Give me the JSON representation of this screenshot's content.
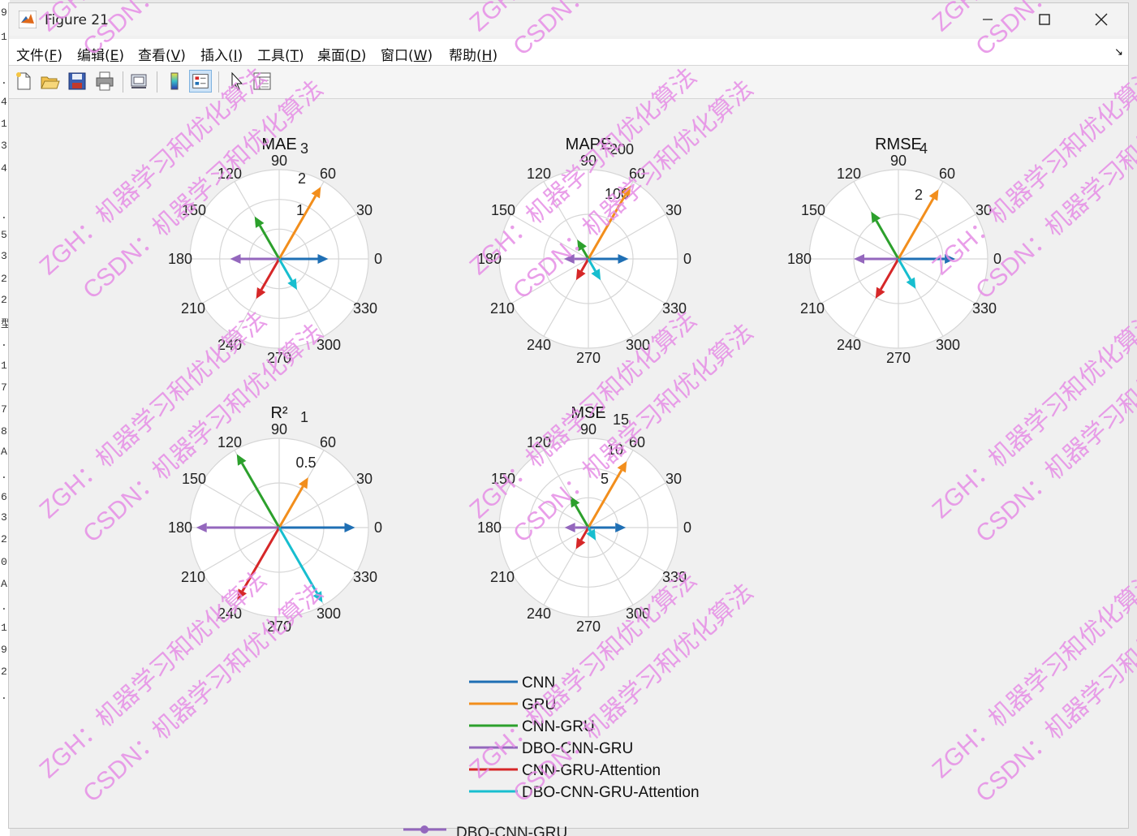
{
  "window": {
    "title": "Figure 21"
  },
  "menu": {
    "items": [
      {
        "label": "文件(",
        "key": "F",
        "tail": ")"
      },
      {
        "label": "编辑(",
        "key": "E",
        "tail": ")"
      },
      {
        "label": "查看(",
        "key": "V",
        "tail": ")"
      },
      {
        "label": "插入(",
        "key": "I",
        "tail": ")"
      },
      {
        "label": "工具(",
        "key": "T",
        "tail": ")"
      },
      {
        "label": "桌面(",
        "key": "D",
        "tail": ")"
      },
      {
        "label": "窗口(",
        "key": "W",
        "tail": ")"
      },
      {
        "label": "帮助(",
        "key": "H",
        "tail": ")"
      }
    ]
  },
  "toolbar": {
    "buttons": [
      "new-figure-icon",
      "open-file-icon",
      "save-icon",
      "print-icon",
      "link-plot-icon",
      "colorbar-icon",
      "legend-icon",
      "edit-plot-cursor-icon",
      "property-inspector-icon"
    ]
  },
  "background_text": {
    "left_gutter": [
      "9",
      "1",
      ".",
      "4",
      "1",
      "3",
      "4",
      ".",
      "5",
      "3",
      "2",
      "2",
      "型",
      ".",
      "1",
      "7",
      "7",
      "8",
      "At",
      ".",
      "6",
      "3",
      "2",
      "0",
      "At",
      ".",
      "1",
      "9",
      "2",
      "."
    ],
    "bottom_legend_fragment": "DBO-CNN-GRU"
  },
  "colors": {
    "CNN": "#1f6fb4",
    "GRU": "#f28e1c",
    "CNN-GRU": "#2ca02c",
    "DBO-CNN-GRU": "#9467bd",
    "CNN-GRU-Attention": "#d62728",
    "DBO-CNN-GRU-Attention": "#17becf",
    "watermark": "#e58de5"
  },
  "angle_labels": [
    "0",
    "30",
    "60",
    "90",
    "120",
    "150",
    "180",
    "210",
    "240",
    "270",
    "300",
    "330"
  ],
  "chart_data": [
    {
      "type": "polar-compass",
      "title": "MAE",
      "rmax": 3,
      "rticks": [
        "1",
        "2",
        "3"
      ],
      "series": [
        {
          "name": "CNN",
          "angle_deg": 0,
          "r": 1.65
        },
        {
          "name": "GRU",
          "angle_deg": 60,
          "r": 2.8
        },
        {
          "name": "CNN-GRU",
          "angle_deg": 120,
          "r": 1.65
        },
        {
          "name": "DBO-CNN-GRU",
          "angle_deg": 180,
          "r": 1.65
        },
        {
          "name": "CNN-GRU-Attention",
          "angle_deg": 240,
          "r": 1.55
        },
        {
          "name": "DBO-CNN-GRU-Attention",
          "angle_deg": 300,
          "r": 1.2
        }
      ]
    },
    {
      "type": "polar-compass",
      "title": "MAPE",
      "rmax": 200,
      "rticks": [
        "100",
        "200"
      ],
      "series": [
        {
          "name": "CNN",
          "angle_deg": 0,
          "r": 90
        },
        {
          "name": "GRU",
          "angle_deg": 60,
          "r": 190
        },
        {
          "name": "CNN-GRU",
          "angle_deg": 120,
          "r": 50
        },
        {
          "name": "DBO-CNN-GRU",
          "angle_deg": 180,
          "r": 55
        },
        {
          "name": "CNN-GRU-Attention",
          "angle_deg": 240,
          "r": 55
        },
        {
          "name": "DBO-CNN-GRU-Attention",
          "angle_deg": 300,
          "r": 55
        }
      ]
    },
    {
      "type": "polar-compass",
      "title": "RMSE",
      "rmax": 4,
      "rticks": [
        "2",
        "4"
      ],
      "series": [
        {
          "name": "CNN",
          "angle_deg": 0,
          "r": 2.55
        },
        {
          "name": "GRU",
          "angle_deg": 60,
          "r": 3.6
        },
        {
          "name": "CNN-GRU",
          "angle_deg": 120,
          "r": 2.45
        },
        {
          "name": "DBO-CNN-GRU",
          "angle_deg": 180,
          "r": 2.0
        },
        {
          "name": "CNN-GRU-Attention",
          "angle_deg": 240,
          "r": 2.05
        },
        {
          "name": "DBO-CNN-GRU-Attention",
          "angle_deg": 300,
          "r": 1.55
        }
      ]
    },
    {
      "type": "polar-compass",
      "title": "R²",
      "rmax": 1,
      "rticks": [
        "0.5",
        "1"
      ],
      "series": [
        {
          "name": "CNN",
          "angle_deg": 0,
          "r": 0.85
        },
        {
          "name": "GRU",
          "angle_deg": 60,
          "r": 0.65
        },
        {
          "name": "CNN-GRU",
          "angle_deg": 120,
          "r": 0.95
        },
        {
          "name": "DBO-CNN-GRU",
          "angle_deg": 180,
          "r": 0.93
        },
        {
          "name": "CNN-GRU-Attention",
          "angle_deg": 240,
          "r": 0.94
        },
        {
          "name": "DBO-CNN-GRU-Attention",
          "angle_deg": 300,
          "r": 0.97
        }
      ]
    },
    {
      "type": "polar-compass",
      "title": "MSE",
      "rmax": 15,
      "rticks": [
        "5",
        "10",
        "15"
      ],
      "series": [
        {
          "name": "CNN",
          "angle_deg": 0,
          "r": 6.3
        },
        {
          "name": "GRU",
          "angle_deg": 60,
          "r": 12.9
        },
        {
          "name": "CNN-GRU",
          "angle_deg": 120,
          "r": 6.1
        },
        {
          "name": "DBO-CNN-GRU",
          "angle_deg": 180,
          "r": 4.0
        },
        {
          "name": "CNN-GRU-Attention",
          "angle_deg": 240,
          "r": 4.2
        },
        {
          "name": "DBO-CNN-GRU-Attention",
          "angle_deg": 300,
          "r": 2.5
        }
      ]
    }
  ],
  "legend": {
    "entries": [
      "CNN",
      "GRU",
      "CNN-GRU",
      "DBO-CNN-GRU",
      "CNN-GRU-Attention",
      "DBO-CNN-GRU-Attention"
    ]
  },
  "watermark": {
    "line1": "ZGH：机器学习和优化算法",
    "line2": "CSDN：机器学习和优化算法"
  }
}
